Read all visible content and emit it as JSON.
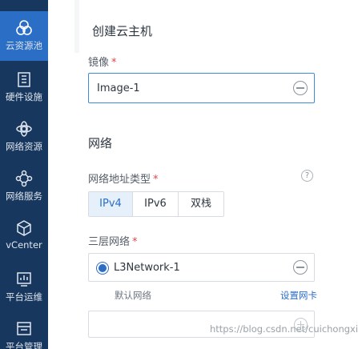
{
  "sidebar": {
    "items": [
      {
        "label": "云资源池",
        "icon": "cloud-resource-pool-icon",
        "active": true
      },
      {
        "label": "硬件设施",
        "icon": "hardware-icon",
        "active": false
      },
      {
        "label": "网络资源",
        "icon": "network-resource-icon",
        "active": false
      },
      {
        "label": "网络服务",
        "icon": "network-service-icon",
        "active": false
      },
      {
        "label": "vCenter",
        "icon": "vcenter-cube-icon",
        "active": false
      },
      {
        "label": "平台运维",
        "icon": "platform-ops-icon",
        "active": false
      },
      {
        "label": "平台管理",
        "icon": "platform-management-icon",
        "active": false
      }
    ]
  },
  "page": {
    "title": "创建云主机"
  },
  "form": {
    "image": {
      "label": "镜像",
      "required_mark": "*",
      "value": "Image-1",
      "action_icon": "remove-circle-icon"
    },
    "network_section": {
      "title": "网络"
    },
    "address_type": {
      "label": "网络地址类型",
      "required_mark": "*",
      "help_icon": "question-circle-icon",
      "help_text": "?",
      "options": [
        "IPv4",
        "IPv6",
        "双栈"
      ],
      "selected": "IPv4"
    },
    "l3_network": {
      "label": "三层网络",
      "required_mark": "*",
      "selected_network": "L3Network-1",
      "default_note": "默认网络",
      "set_nic_link": "设置网卡",
      "action_icon": "remove-circle-icon",
      "add_icon": "add-circle-icon"
    }
  },
  "watermark": {
    "text": "https://blog.csdn.net/cuichongxin"
  },
  "colors": {
    "sidebar_bg": "#17375e",
    "sidebar_active": "#2b6ec6",
    "accent": "#2b6ec6",
    "required": "#e0474c"
  }
}
